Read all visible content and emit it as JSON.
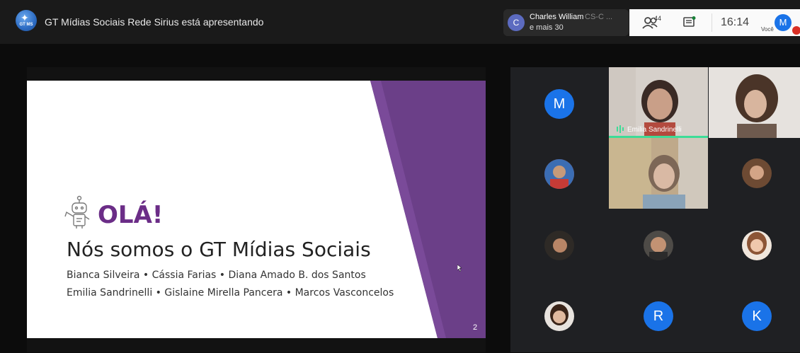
{
  "topbar": {
    "presenter_title": "GT Mídias Sociais Rede Sirius está apresentando",
    "presenter_logo_text": "GT MS",
    "speaker": {
      "avatar_letter": "C",
      "name": "Charles William",
      "name_suffix": "CS-C ...",
      "more": "e mais 30"
    },
    "people_count": "44",
    "clock": "16:14",
    "you_label": "Você",
    "you_avatar_letter": "M"
  },
  "slide": {
    "hello": "OLÁ!",
    "headline": "Nós somos o GT Mídias Sociais",
    "members_line1": "Bianca Silveira • Cássia Farias • Diana Amado B. dos Santos",
    "members_line2": "Emilia Sandrinelli • Gislaine Mirella Pancera • Marcos Vasconcelos",
    "page_number": "2",
    "accent_color": "#6b2d87"
  },
  "grid": {
    "active_speaker_name": "Emilia Sandrinelli",
    "letters": [
      "M",
      "R",
      "K"
    ],
    "avatar_color": "#1a73e8",
    "speaking_color": "#3ddc97"
  }
}
